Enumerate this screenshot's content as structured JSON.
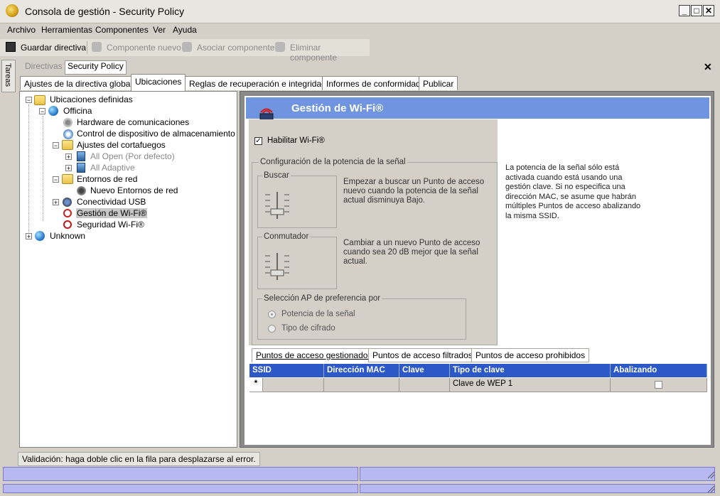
{
  "window": {
    "title": "Consola de gestión - Security Policy"
  },
  "menu": [
    "Archivo",
    "Herramientas",
    "Componentes",
    "Ver",
    "Ayuda"
  ],
  "toolbar": {
    "save": "Guardar directiva",
    "new_component": "Componente nuevo",
    "associate_component": "Asociar componente",
    "delete_component": "Eliminar componente"
  },
  "side_strip": {
    "tareas": "Tareas"
  },
  "doc_tabs": {
    "directivas": "Directivas",
    "security_policy": "Security Policy"
  },
  "subtabs": [
    "Ajustes de la directiva global",
    "Ubicaciones",
    "Reglas de recuperación e integridad",
    "Informes de conformidad",
    "Publicar"
  ],
  "tree": {
    "root": "Ubicaciones definidas",
    "officina": "Officina",
    "hardware": "Hardware de comunicaciones",
    "storage": "Control de dispositivo de almacenamiento",
    "firewall": "Ajustes del cortafuegos",
    "all_open": "All Open (Por defecto)",
    "all_adaptive": "All Adaptive",
    "network_envs": "Entornos de red",
    "new_network_env": "Nuevo Entornos de red",
    "usb": "Conectividad USB",
    "wifi_mgmt": "Gestión de Wi-Fi®",
    "wifi_security": "Seguridad Wi-Fi®",
    "unknown": "Unknown"
  },
  "panel": {
    "title": "Gestión de Wi-Fi®",
    "enable_wifi": "Habilitar Wi-Fi®",
    "signal_group": "Configuración de la potencia de la señal",
    "search_label": "Buscar",
    "search_desc": "Empezar a buscar un Punto de acceso nuevo cuando la potencia de la señal actual disminuya Bajo.",
    "switch_label": "Conmutador",
    "switch_desc": "Cambiar a un nuevo Punto de acceso cuando sea 20 dB mejor que la señal actual.",
    "ap_pref_group": "Selección AP de preferencia por",
    "opt_signal": "Potencia de la señal",
    "opt_cipher": "Tipo de cifrado",
    "info": "La potencia de la señal sólo está activada cuando está usando una gestión clave. Si no especifica una dirección MAC, se asume que habrán múltiples Puntos de acceso abalizando la misma SSID."
  },
  "ap_tabs": [
    "Puntos de acceso gestionados",
    "Puntos de acceso filtrados",
    "Puntos de acceso prohibidos"
  ],
  "grid": {
    "headers": [
      "SSID",
      "Dirección MAC",
      "Clave",
      "Tipo de clave",
      "Abalizando"
    ],
    "row": {
      "new_marker": "*",
      "key_type": "Clave de WEP 1",
      "beaconing_checked": false
    }
  },
  "status": {
    "validation": "Validación: haga doble clic en la fila para desplazarse al error."
  },
  "colors": {
    "header_band": "#6f95e0",
    "grid_header": "#2d59c8",
    "statusbar": "#b8b9f2"
  }
}
